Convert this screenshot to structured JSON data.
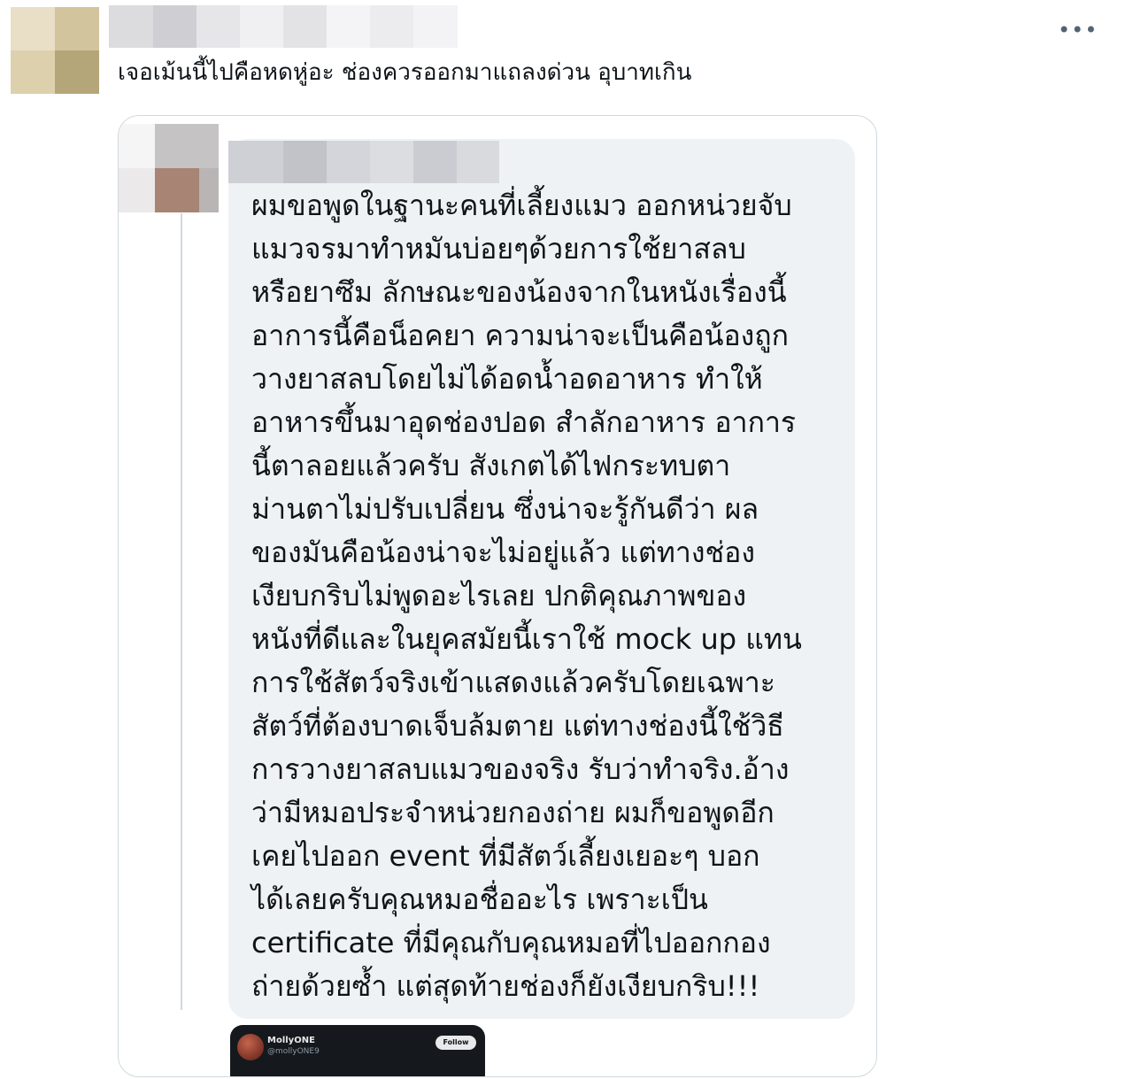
{
  "post": {
    "text": "เจอเม้นนี้ไปคือหดหู่อะ ช่องควรออกมาแถลงด่วน อุบาทเกิน",
    "more_label": "•••"
  },
  "quote": {
    "lines": [
      "ผมขอพูดในฐานะคนที่เลี้ยงแมว ออกหน่วยจับ",
      "แมวจรมาทำหมันบ่อยๆด้วยการใช้ยาสลบ",
      "หรือยาซึม ลักษณะของน้องจากในหนังเรื่องนี้",
      "อาการนี้คือน็อคยา ความน่าจะเป็นคือน้องถูก",
      "วางยาสลบโดยไม่ได้อดน้ำอดอาหาร ทำให้",
      "อาหารขึ้นมาอุดช่องปอด สำลักอาหาร อาการ",
      "นี้ตาลอยแล้วครับ สังเกตได้ไฟกระทบตา",
      "ม่านตาไม่ปรับเปลี่ยน ซึ่งน่าจะรู้กันดีว่า ผล",
      "ของมันคือน้องน่าจะไม่อยู่แล้ว แต่ทางช่อง",
      "เงียบกริบไม่พูดอะไรเลย ปกติคุณภาพของ",
      "หนังที่ดีและในยุคสมัยนี้เราใช้ mock up แทน",
      "การใช้สัตว์จริงเข้าแสดงแล้วครับโดยเฉพาะ",
      "สัตว์ที่ต้องบาดเจ็บล้มตาย แต่ทางช่องนี้ใช้วิธี",
      "การวางยาสลบแมวของจริง รับว่าทำจริง.อ้าง",
      "ว่ามีหมอประจำหน่วยกองถ่าย ผมก็ขอพูดอีก",
      "เคยไปออก event ที่มีสัตว์เลี้ยงเยอะๆ บอก",
      "ได้เลยครับคุณหมอชื่ออะไร เพราะเป็น",
      "certificate ที่มีคุณกับคุณหมอที่ไปออกกอง",
      "ถ่ายด้วยซ้ำ แต่สุดท้ายช่องก็ยังเงียบกริบ!!!"
    ]
  },
  "embed": {
    "name": "MollyONE",
    "handle": "@mollyONE9",
    "follow_label": "Follow"
  },
  "colors": {
    "text": "#0f1419",
    "bubble": "#eff2f5",
    "border": "#cfd9de",
    "embed_bg": "#15181c"
  }
}
